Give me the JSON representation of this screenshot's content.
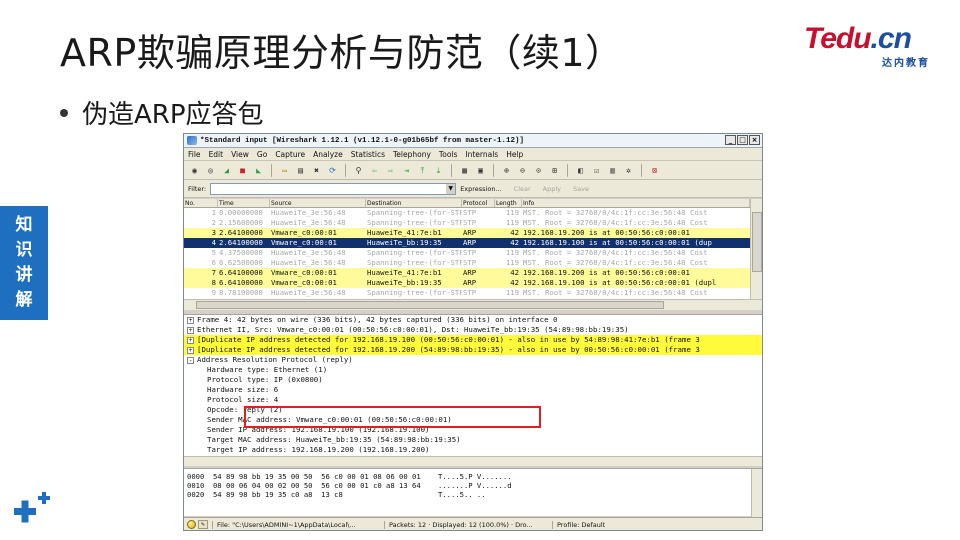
{
  "slide": {
    "title": "ARP欺骗原理分析与防范（续1）",
    "bullet": "伪造ARP应答包",
    "logo_brand": "Tedu",
    "logo_cn": ".cn",
    "logo_sub": "达内教育",
    "side_tab": [
      "知",
      "识",
      "讲",
      "解"
    ],
    "colors": {
      "accent_blue": "#1f6fc0",
      "logo_red": "#c8102e",
      "logo_blue": "#1c4fa0",
      "highlight_red": "#e02020"
    }
  },
  "wireshark": {
    "title": "*Standard input   [Wireshark 1.12.1  (v1.12.1-0-g01b65bf from master-1.12)]",
    "title_buttons": [
      "_",
      "□",
      "×"
    ],
    "menu": [
      "File",
      "Edit",
      "View",
      "Go",
      "Capture",
      "Analyze",
      "Statistics",
      "Telephony",
      "Tools",
      "Internals",
      "Help"
    ],
    "toolbar_icons": [
      "interface-list-icon",
      "capture-options-icon",
      "start-capture-icon",
      "stop-capture-icon",
      "restart-capture-icon",
      "open-file-icon",
      "save-file-icon",
      "close-file-icon",
      "reload-icon",
      "find-icon",
      "back-icon",
      "forward-icon",
      "go-to-icon",
      "first-packet-icon",
      "last-packet-icon",
      "colorize-icon",
      "autoscroll-icon",
      "zoom-in-icon",
      "zoom-out-icon",
      "zoom-normal-icon",
      "resize-columns-icon",
      "capture-filters-icon",
      "display-filters-icon",
      "coloring-rules-icon",
      "preferences-icon",
      "help-icon"
    ],
    "filter": {
      "label": "Filter:",
      "value": "",
      "expression": "Expression...",
      "clear": "Clear",
      "apply": "Apply",
      "save": "Save"
    },
    "columns": [
      "No.",
      "Time",
      "Source",
      "Destination",
      "Protocol",
      "Length",
      "Info"
    ],
    "packets": [
      {
        "no": "1",
        "time": "0.00000000",
        "src": "HuaweiTe_3e:56:48",
        "dst": "Spanning-tree-(for-STP",
        "proto": "STP",
        "len": "119",
        "info": "MST. Root = 32768/0/4c:1f:cc:3e:56:48  Cost",
        "kind": "stp"
      },
      {
        "no": "2",
        "time": "2.15600000",
        "src": "HuaweiTe_3e:56:48",
        "dst": "Spanning-tree-(for-STP",
        "proto": "STP",
        "len": "119",
        "info": "MST. Root = 32768/0/4c:1f:cc:3e:56:48  Cost",
        "kind": "stp"
      },
      {
        "no": "3",
        "time": "2.64100000",
        "src": "Vmware_c0:00:01",
        "dst": "HuaweiTe_41:7e:b1",
        "proto": "ARP",
        "len": "42",
        "info": "192.168.19.200 is at 00:50:56:c0:00:01",
        "kind": "arp"
      },
      {
        "no": "4",
        "time": "2.64100000",
        "src": "Vmware_c0:00:01",
        "dst": "HuaweiTe_bb:19:35",
        "proto": "ARP",
        "len": "42",
        "info": "192.168.19.100 is at 00:50:56:c0:00:01 (dup",
        "kind": "sel"
      },
      {
        "no": "5",
        "time": "4.37500000",
        "src": "HuaweiTe_3e:56:48",
        "dst": "Spanning-tree-(for-STP",
        "proto": "STP",
        "len": "119",
        "info": "MST. Root = 32768/0/4c:1f:cc:3e:56:48  Cost",
        "kind": "stp"
      },
      {
        "no": "6",
        "time": "6.62500000",
        "src": "HuaweiTe_3e:56:48",
        "dst": "Spanning-tree-(for-STP",
        "proto": "STP",
        "len": "119",
        "info": "MST. Root = 32768/0/4c:1f:cc:3e:56:48  Cost",
        "kind": "stp"
      },
      {
        "no": "7",
        "time": "6.64100000",
        "src": "Vmware_c0:00:01",
        "dst": "HuaweiTe_41:7e:b1",
        "proto": "ARP",
        "len": "42",
        "info": "192.168.19.200 is at 00:50:56:c0:00:01",
        "kind": "arp"
      },
      {
        "no": "8",
        "time": "6.64100000",
        "src": "Vmware_c0:00:01",
        "dst": "HuaweiTe_bb:19:35",
        "proto": "ARP",
        "len": "42",
        "info": "192.168.19.100 is at 00:50:56:c0:00:01 (dupl",
        "kind": "arp"
      },
      {
        "no": "9",
        "time": "8.78100000",
        "src": "HuaweiTe_3e:56:48",
        "dst": "Spanning-tree-(for-STP",
        "proto": "STP",
        "len": "119",
        "info": "MST. Root = 32768/0/4c:1f:cc:3e:56:48  Cost",
        "kind": "stp"
      }
    ],
    "details": [
      {
        "text": "Frame 4: 42 bytes on wire (336 bits), 42 bytes captured (336 bits) on interface 0",
        "exp": "+",
        "warn": false,
        "child": false
      },
      {
        "text": "Ethernet II, Src: Vmware_c0:00:01 (00:50:56:c0:00:01), Dst: HuaweiTe_bb:19:35 (54:89:98:bb:19:35)",
        "exp": "+",
        "warn": false,
        "child": false
      },
      {
        "text": "[Duplicate IP address detected for 192.168.19.100 (00:50:56:c0:00:01) - also in use by 54:89:98:41:7e:b1 (frame 3",
        "exp": "+",
        "warn": true,
        "child": false
      },
      {
        "text": "[Duplicate IP address detected for 192.168.19.200 (54:89:98:bb:19:35) - also in use by 00:50:56:c0:00:01 (frame 3",
        "exp": "+",
        "warn": true,
        "child": false
      },
      {
        "text": "Address Resolution Protocol (reply)",
        "exp": "-",
        "warn": false,
        "child": false
      },
      {
        "text": "Hardware type: Ethernet (1)",
        "exp": "",
        "warn": false,
        "child": true
      },
      {
        "text": "Protocol type: IP (0x0800)",
        "exp": "",
        "warn": false,
        "child": true
      },
      {
        "text": "Hardware size: 6",
        "exp": "",
        "warn": false,
        "child": true
      },
      {
        "text": "Protocol size: 4",
        "exp": "",
        "warn": false,
        "child": true
      },
      {
        "text": "Opcode: reply (2)",
        "exp": "",
        "warn": false,
        "child": true
      },
      {
        "text": "Sender MAC address: Vmware_c0:00:01 (00:50:56:c0:00:01)",
        "exp": "",
        "warn": false,
        "child": true
      },
      {
        "text": "Sender IP address: 192.168.19.100 (192.168.19.100)",
        "exp": "",
        "warn": false,
        "child": true
      },
      {
        "text": "Target MAC address: HuaweiTe_bb:19:35 (54:89:98:bb:19:35)",
        "exp": "",
        "warn": false,
        "child": true
      },
      {
        "text": "Target IP address: 192.168.19.200 (192.168.19.200)",
        "exp": "",
        "warn": false,
        "child": true
      }
    ],
    "bytes": [
      "0000  54 89 98 bb 19 35 00 50  56 c0 00 01 08 06 00 01    T....5.P V.......",
      "0010  08 00 06 04 00 02 00 50  56 c0 00 01 c0 a8 13 64    .......P V......d",
      "0020  54 89 98 bb 19 35 c0 a8  13 c8                      T....5.. .."
    ],
    "status": {
      "file": "File: \"C:\\Users\\ADMINI~1\\AppData\\Local\\...",
      "packets": "Packets: 12 · Displayed: 12 (100.0%) · Dro...",
      "profile": "Profile: Default"
    }
  }
}
